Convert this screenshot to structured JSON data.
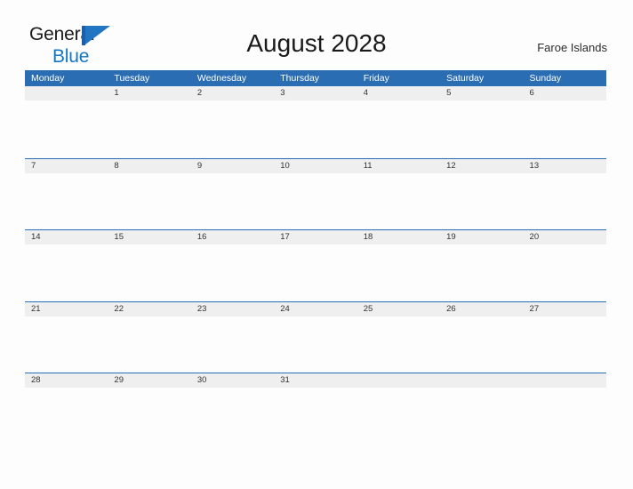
{
  "brand": {
    "word1": "General",
    "word2": "Blue",
    "mark": "triangle-flag-logo"
  },
  "header": {
    "title": "August 2028",
    "region": "Faroe Islands"
  },
  "colors": {
    "header_blue": "#2a6db3",
    "band_gray": "#efefef",
    "brand_blue": "#1277c9",
    "page_background": "#fdfdfd",
    "text_dark": "#1a1a1a"
  },
  "calendar": {
    "weekdays": [
      "Monday",
      "Tuesday",
      "Wednesday",
      "Thursday",
      "Friday",
      "Saturday",
      "Sunday"
    ],
    "weeks": [
      [
        "",
        "1",
        "2",
        "3",
        "4",
        "5",
        "6"
      ],
      [
        "7",
        "8",
        "9",
        "10",
        "11",
        "12",
        "13"
      ],
      [
        "14",
        "15",
        "16",
        "17",
        "18",
        "19",
        "20"
      ],
      [
        "21",
        "22",
        "23",
        "24",
        "25",
        "26",
        "27"
      ],
      [
        "28",
        "29",
        "30",
        "31",
        "",
        "",
        ""
      ]
    ]
  }
}
